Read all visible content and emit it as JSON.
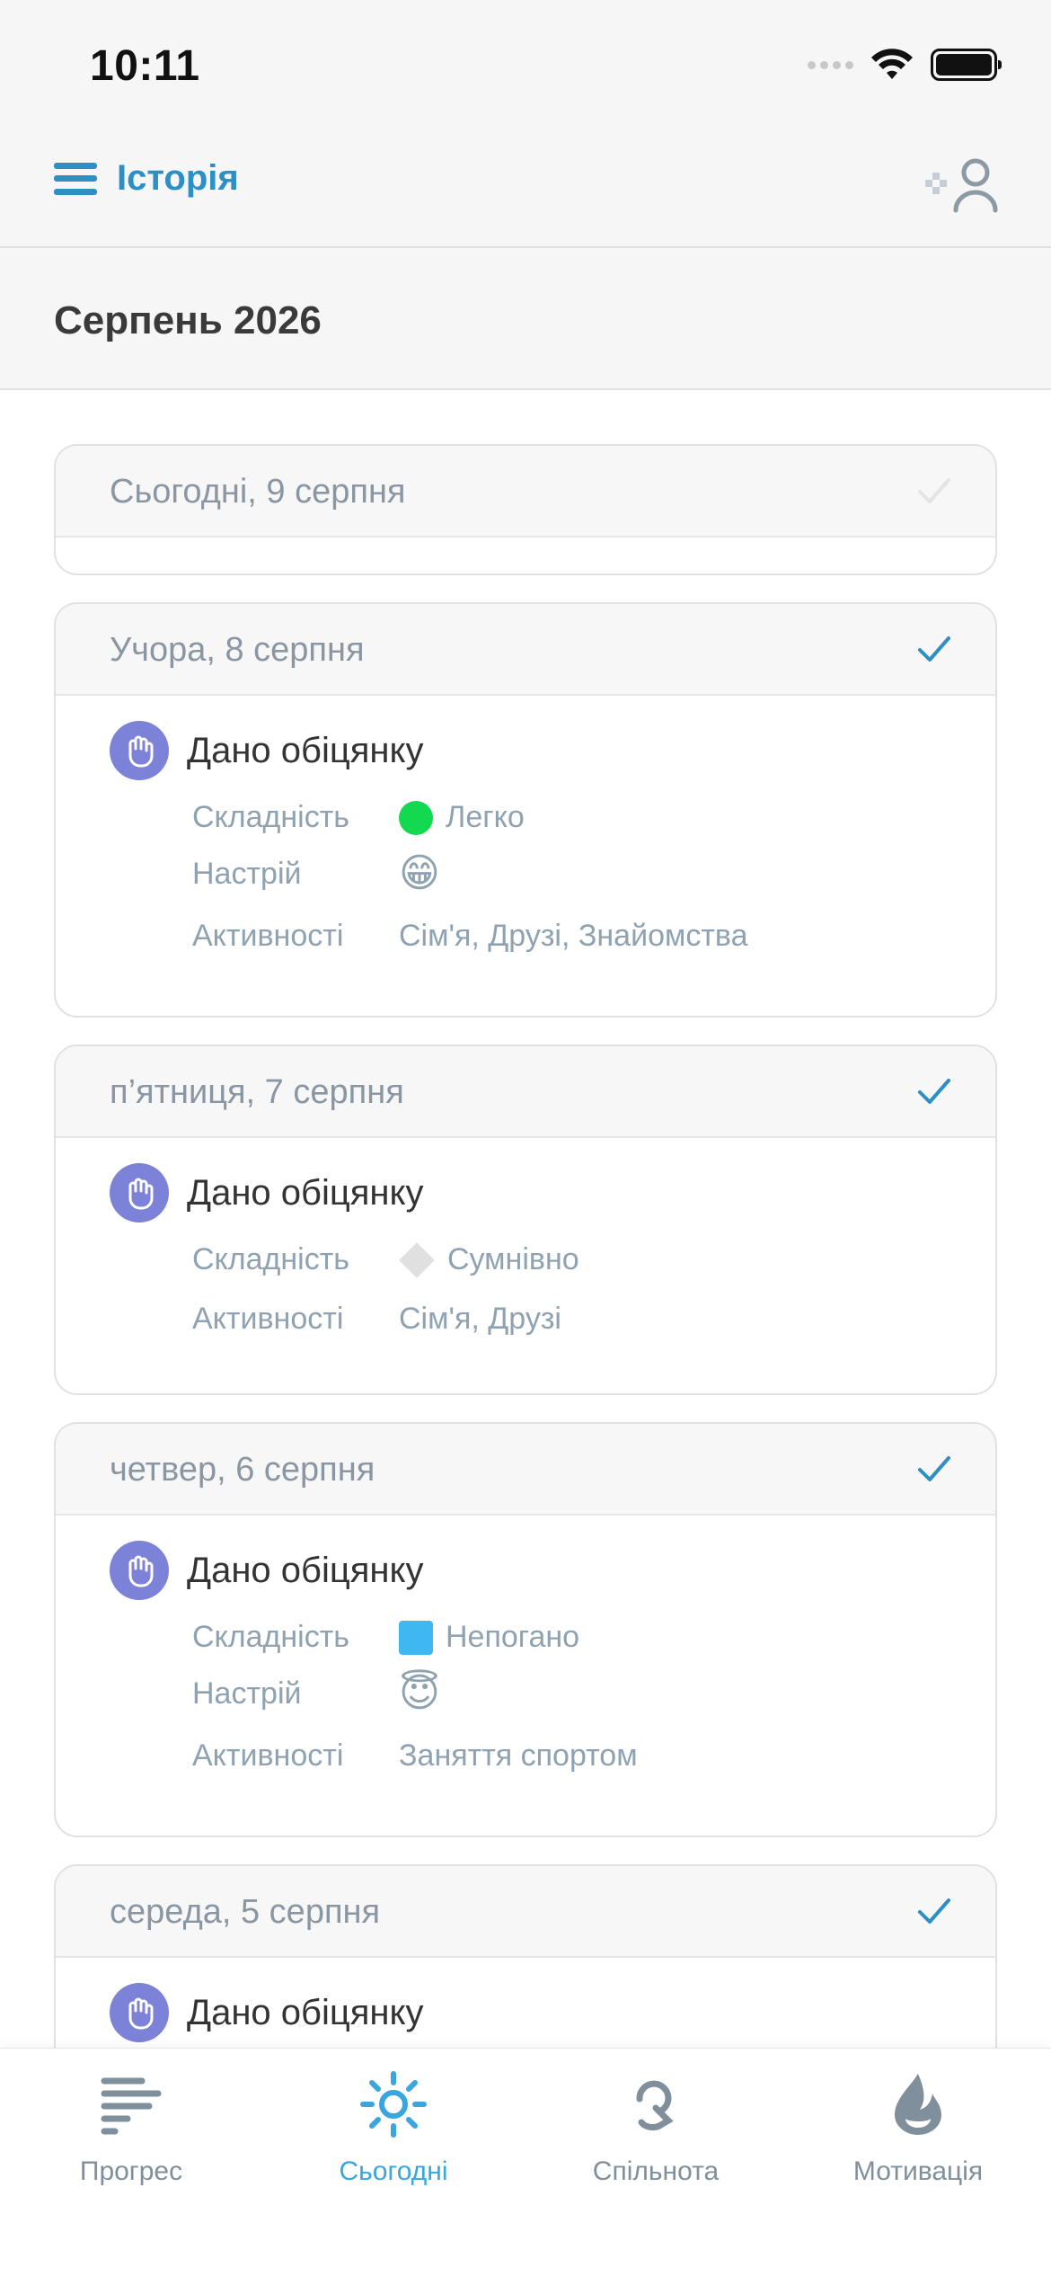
{
  "status_bar": {
    "time": "10:11"
  },
  "nav": {
    "title": "Історія"
  },
  "month": {
    "title": "Серпень 2026"
  },
  "attr_labels": {
    "difficulty": "Складність",
    "mood": "Настрій",
    "activities": "Активності"
  },
  "days": [
    {
      "date": "Сьогодні, 9 серпня"
    },
    {
      "date": "Учора, 8 серпня",
      "entry": "Дано обіцянку",
      "difficulty": "Легко",
      "mood_emoji": "😁",
      "activities": "Сім'я, Друзі, Знайомства"
    },
    {
      "date": "п’ятниця, 7 серпня",
      "entry": "Дано обіцянку",
      "difficulty": "Сумнівно",
      "activities": "Сім'я, Друзі"
    },
    {
      "date": "четвер, 6 серпня",
      "entry": "Дано обіцянку",
      "difficulty": "Непогано",
      "mood_emoji": "😇",
      "activities": "Заняття спортом"
    },
    {
      "date": "середа, 5 серпня",
      "entry": "Дано обіцянку"
    }
  ],
  "tabs": [
    {
      "label": "Прогрес",
      "icon": "progress-icon"
    },
    {
      "label": "Сьогодні",
      "icon": "sun-icon",
      "active": true
    },
    {
      "label": "Спільнота",
      "icon": "community-icon"
    },
    {
      "label": "Мотивація",
      "icon": "motivation-icon"
    }
  ],
  "colors": {
    "accent": "#2d8fc4",
    "tab_active": "#3aa6e0",
    "promise_icon_bg": "#7b82d8",
    "difficulty_easy": "#12d94f",
    "difficulty_ok": "#3fb8f2"
  }
}
